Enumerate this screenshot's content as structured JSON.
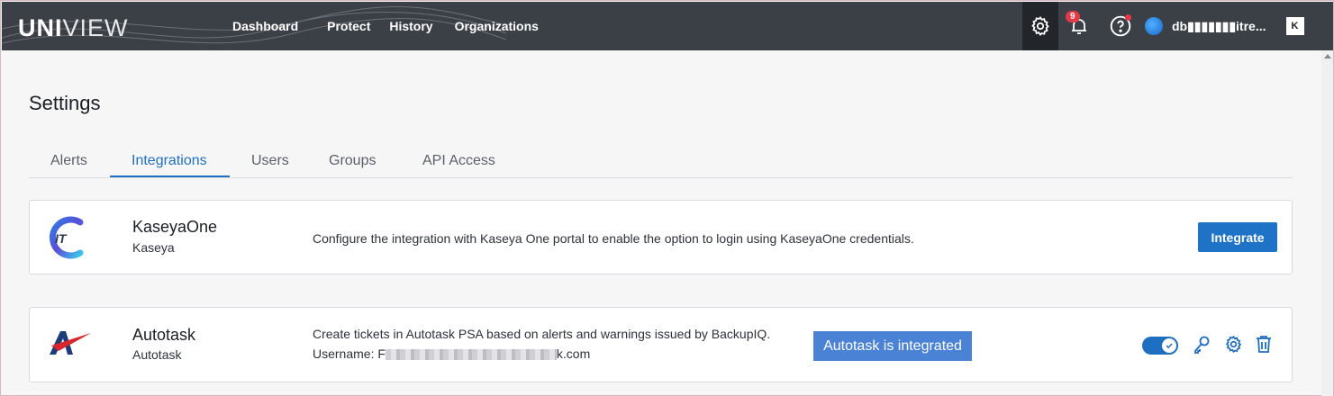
{
  "header": {
    "logo_bold": "UNI",
    "logo_thin": "VIEW",
    "nav": [
      "Dashboard",
      "Protect",
      "History",
      "Organizations"
    ],
    "notification_count": "9",
    "user_name": "db▮▮▮▮▮▮▮itre...",
    "brand_badge": "K"
  },
  "page": {
    "title": "Settings",
    "tabs": [
      "Alerts",
      "Integrations",
      "Users",
      "Groups",
      "API Access"
    ],
    "active_tab": "Integrations"
  },
  "integrations": [
    {
      "title": "KaseyaOne",
      "subtitle": "Kaseya",
      "description": "Configure the integration with Kaseya One portal to enable the option to login using KaseyaOne credentials.",
      "button": "Integrate",
      "logo_icon": "kaseya-it-icon"
    },
    {
      "title": "Autotask",
      "subtitle": "Autotask",
      "description": "Create tickets in Autotask PSA based on alerts and warnings issued by BackupIQ.",
      "username_label": "Username: F",
      "username_suffix": "k.com",
      "status_tooltip": "Autotask is integrated",
      "enabled": true,
      "logo_icon": "autotask-icon"
    }
  ],
  "colors": {
    "topbar": "#3b4047",
    "accent": "#1e73c7",
    "tooltip": "#4a82d6",
    "badge": "#e53945"
  }
}
